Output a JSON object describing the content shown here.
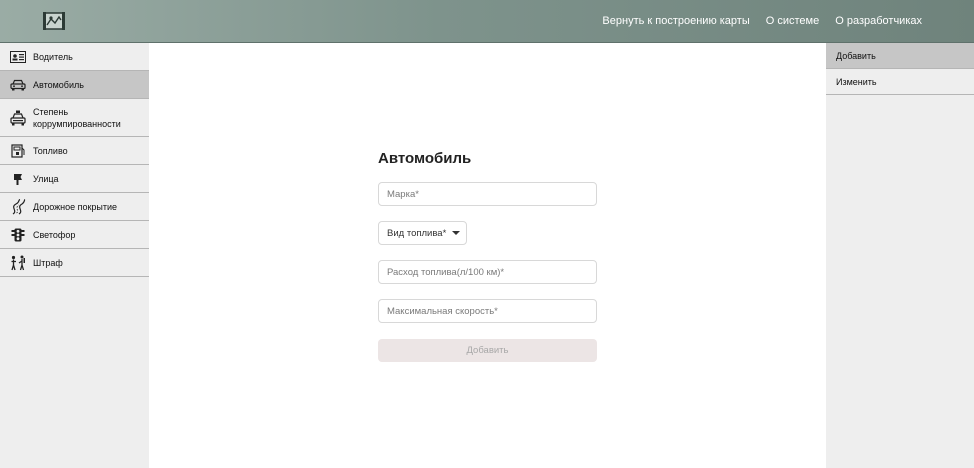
{
  "topbar": {
    "logo_icon": "map-logo-icon",
    "nav": [
      {
        "label": "Вернуть к построению карты"
      },
      {
        "label": "О системе"
      },
      {
        "label": "О разработчиках"
      }
    ]
  },
  "sidebar": {
    "active_index": 1,
    "items": [
      {
        "label": "Водитель",
        "icon": "driver-license-icon"
      },
      {
        "label": "Автомобиль",
        "icon": "car-icon"
      },
      {
        "label": "Степень коррумпированности",
        "icon": "police-car-icon"
      },
      {
        "label": "Топливо",
        "icon": "fuel-icon"
      },
      {
        "label": "Улица",
        "icon": "street-sign-icon"
      },
      {
        "label": "Дорожное покрытие",
        "icon": "road-icon"
      },
      {
        "label": "Светофор",
        "icon": "traffic-light-icon"
      },
      {
        "label": "Штраф",
        "icon": "fine-icon"
      }
    ]
  },
  "form": {
    "title": "Автомобиль",
    "brand_placeholder": "Марка*",
    "fuel_type_label": "Вид топлива*",
    "consumption_placeholder": "Расход топлива(л/100 км)*",
    "max_speed_placeholder": "Максимальная скорость*",
    "submit_label": "Добавить"
  },
  "right_panel": {
    "active_index": 0,
    "items": [
      {
        "label": "Добавить"
      },
      {
        "label": "Изменить"
      }
    ]
  }
}
